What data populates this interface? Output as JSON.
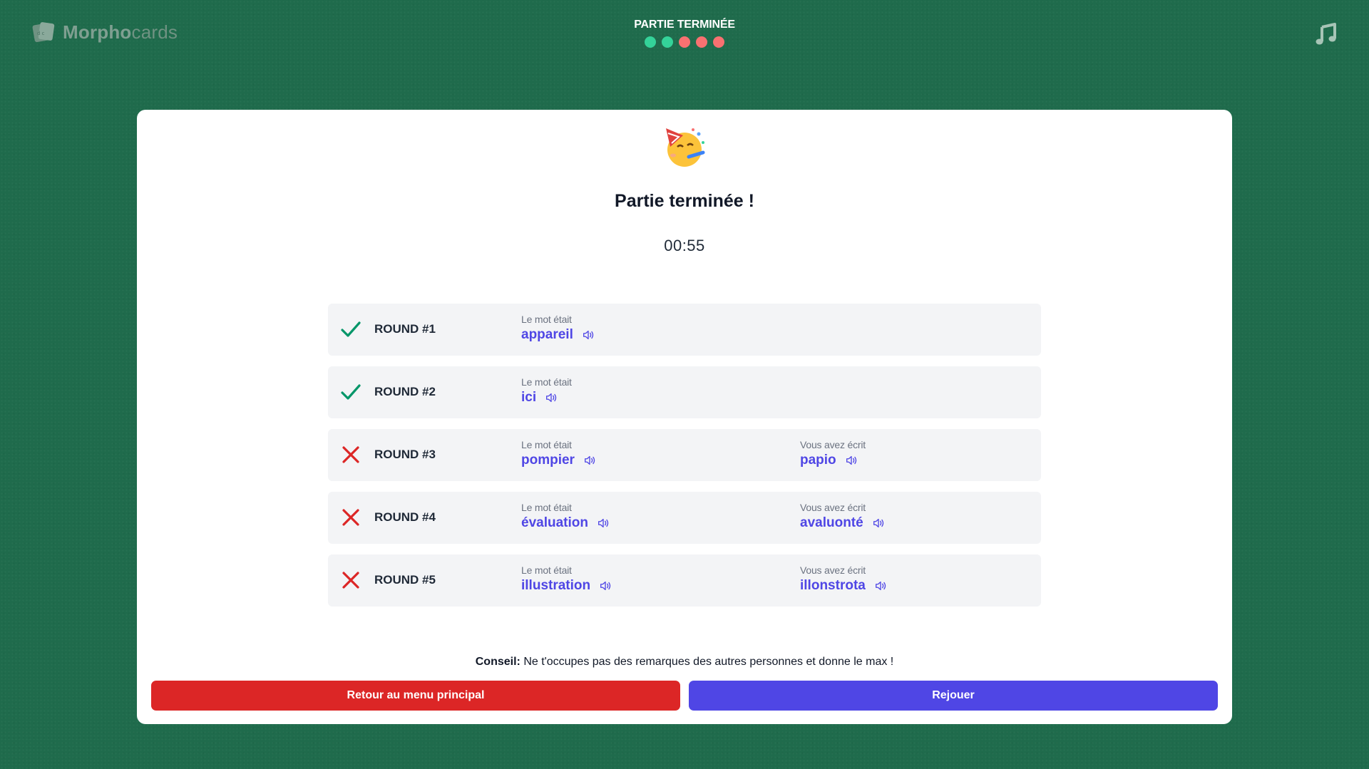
{
  "header": {
    "logo_part1": "Morpho",
    "logo_part2": "cards",
    "status_title": "PARTIE TERMINÉE",
    "progress_dots": [
      "#34d399",
      "#34d399",
      "#f87171",
      "#f87171",
      "#f87171"
    ],
    "music_icon": "music-note-icon"
  },
  "card": {
    "emoji": "🥳",
    "title": "Partie terminée !",
    "timer": "00:55"
  },
  "rounds": [
    {
      "label": "ROUND #1",
      "correct": true,
      "word_caption": "Le mot était",
      "word": "appareil",
      "written_caption": "",
      "written": ""
    },
    {
      "label": "ROUND #2",
      "correct": true,
      "word_caption": "Le mot était",
      "word": "ici",
      "written_caption": "",
      "written": ""
    },
    {
      "label": "ROUND #3",
      "correct": false,
      "word_caption": "Le mot était",
      "word": "pompier",
      "written_caption": "Vous avez écrit",
      "written": "papio"
    },
    {
      "label": "ROUND #4",
      "correct": false,
      "word_caption": "Le mot était",
      "word": "évaluation",
      "written_caption": "Vous avez écrit",
      "written": "avaluonté"
    },
    {
      "label": "ROUND #5",
      "correct": false,
      "word_caption": "Le mot était",
      "word": "illustration",
      "written_caption": "Vous avez écrit",
      "written": "illonstrota"
    }
  ],
  "tip": {
    "label": "Conseil:",
    "text": " Ne t'occupes pas des remarques des autres personnes et donne le max !"
  },
  "buttons": {
    "menu": "Retour au menu principal",
    "replay": "Rejouer"
  },
  "colors": {
    "background": "#1f6b4c",
    "accent": "#4f46e5",
    "danger": "#dc2626",
    "success": "#059669"
  }
}
